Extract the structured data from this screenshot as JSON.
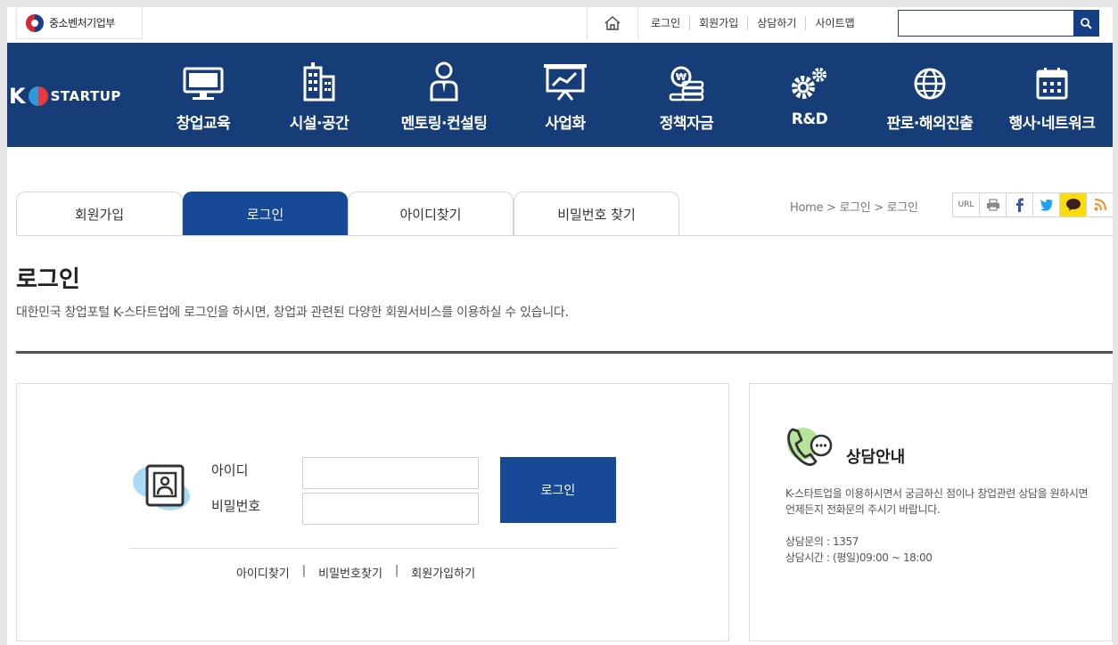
{
  "util": {
    "ministry": "중소벤처기업부",
    "links": [
      "로그인",
      "회원가입",
      "상담하기",
      "사이트맵"
    ],
    "search_placeholder": ""
  },
  "brand": {
    "k": "K",
    "name": "STARTUP"
  },
  "gnb": [
    {
      "label": "창업교육",
      "icon": "monitor-icon"
    },
    {
      "label": "시설·공간",
      "icon": "building-icon"
    },
    {
      "label": "멘토링·컨설팅",
      "icon": "mentor-icon"
    },
    {
      "label": "사업화",
      "icon": "presentation-chart-icon"
    },
    {
      "label": "정책자금",
      "icon": "money-stack-icon"
    },
    {
      "label": "R&D",
      "icon": "gears-icon"
    },
    {
      "label": "판로·해외진출",
      "icon": "globe-icon"
    },
    {
      "label": "행사·네트워크",
      "icon": "calendar-icon"
    }
  ],
  "tabs": [
    "회원가입",
    "로그인",
    "아이디찾기",
    "비밀번호 찾기"
  ],
  "active_tab": 1,
  "breadcrumb": "Home > 로그인 > 로그인",
  "share": {
    "url": "URL"
  },
  "page": {
    "title": "로그인",
    "description": "대한민국 창업포털 K-스타트업에 로그인을 하시면, 창업과 관련된 다양한 회원서비스를 이용하실 수 있습니다."
  },
  "login": {
    "id_label": "아이디",
    "pw_label": "비밀번호",
    "button": "로그인",
    "links": [
      "아이디찾기",
      "비밀번호찾기",
      "회원가입하기"
    ],
    "separator": "|"
  },
  "consult": {
    "title": "상담안내",
    "description": "K-스타트업을 이용하시면서 궁금하신 점이나 창업관련 상담을 원하시면 언제든지 전화문의 주시기 바랍니다.",
    "phone": "상담문의 : 1357",
    "hours": "상담시간 : (평일)09:00 ~ 18:00"
  },
  "colors": {
    "navy": "#163d77",
    "accent_blue": "#164a96"
  }
}
